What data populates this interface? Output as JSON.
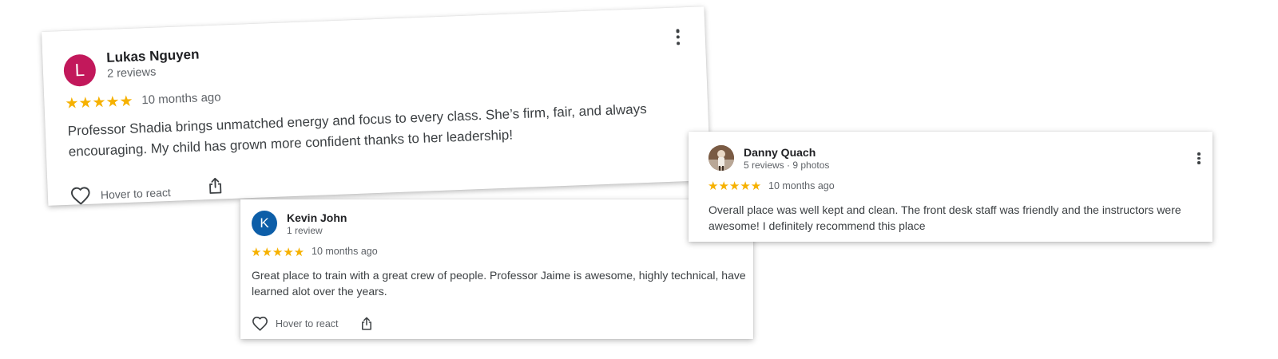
{
  "colors": {
    "star": "#f6b100",
    "avatar_lukas": "#c2185b",
    "avatar_kevin": "#0d5ea8",
    "text_primary": "#202124",
    "text_secondary": "#5f6368"
  },
  "reviews": [
    {
      "avatar_letter": "L",
      "name": "Lukas Nguyen",
      "meta": "2 reviews",
      "rating": 5,
      "stars": "★★★★★",
      "when": "10 months ago",
      "text": "Professor Shadia brings unmatched energy and focus to every class. She’s firm, fair, and always encouraging. My child has grown more confident thanks to her leadership!",
      "react_label": "Hover to react",
      "icons": [
        "more-vert-icon",
        "heart-icon",
        "share-icon"
      ]
    },
    {
      "avatar_letter": "K",
      "name": "Kevin John",
      "meta": "1 review",
      "rating": 5,
      "stars": "★★★★★",
      "when": "10 months ago",
      "text": "Great place to train with a great crew of people. Professor Jaime is awesome, highly technical, have learned alot over the years.",
      "react_label": "Hover to react",
      "icons": [
        "heart-icon",
        "share-icon"
      ]
    },
    {
      "avatar_letter": "",
      "name": "Danny Quach",
      "meta": "5 reviews · 9 photos",
      "rating": 5,
      "stars": "★★★★★",
      "when": "10 months ago",
      "text": "Overall place was well kept and clean. The front desk staff was friendly and the instructors were awesome! I definitely recommend this place",
      "icons": [
        "more-vert-icon"
      ]
    }
  ]
}
